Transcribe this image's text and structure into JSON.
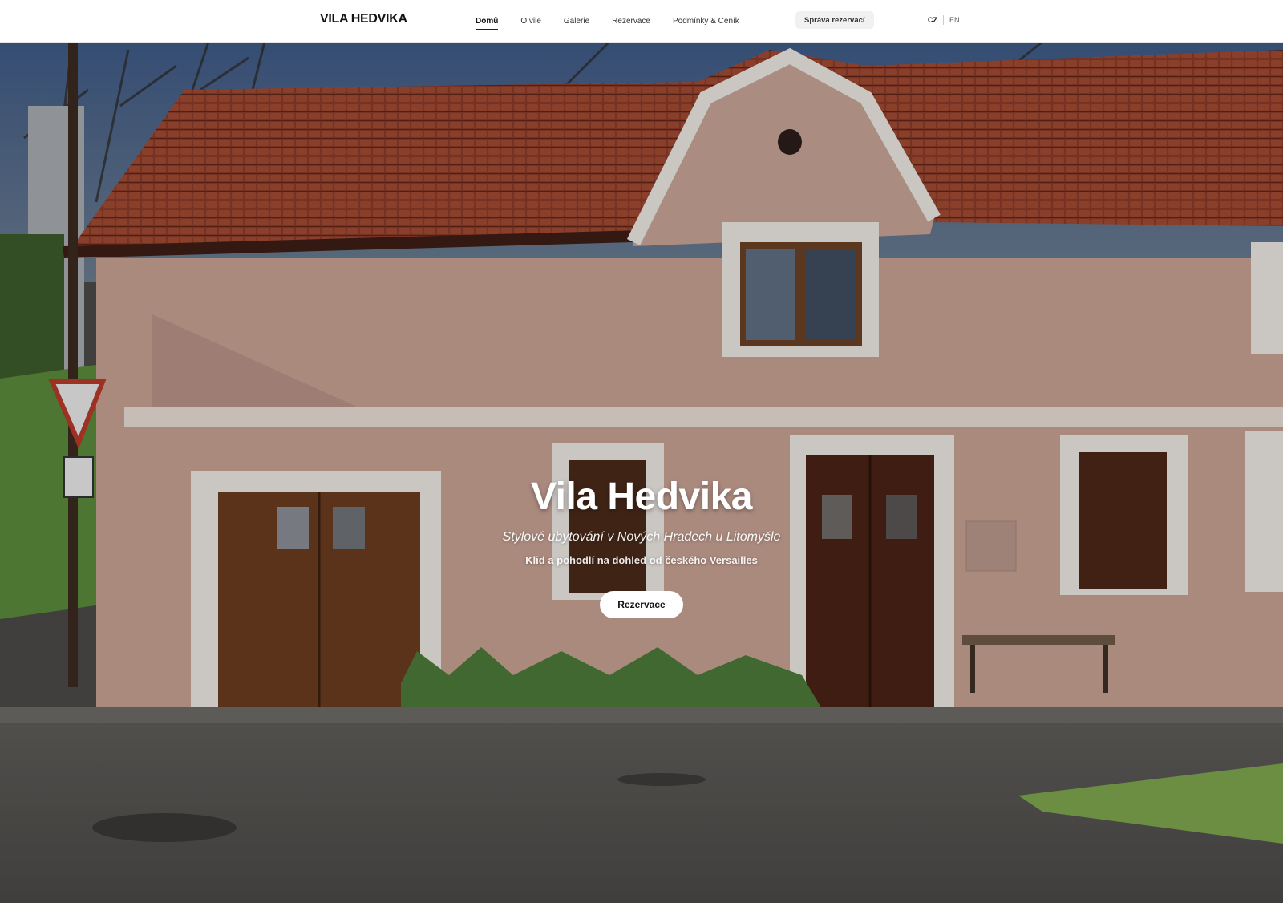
{
  "header": {
    "logo": "VILA HEDVIKA",
    "nav": [
      {
        "label": "Domů",
        "active": true
      },
      {
        "label": "O vile"
      },
      {
        "label": "Galerie"
      },
      {
        "label": "Rezervace"
      },
      {
        "label": "Podmínky & Ceník"
      }
    ],
    "manage_label": "Správa rezervací",
    "lang_cz": "CZ",
    "lang_en": "EN"
  },
  "hero": {
    "title": "Vila Hedvika",
    "subtitle": "Stylové ubytování v Nových Hradech u Litomyšle",
    "tagline": "Klid a pohodlí na dohled od českého Versailles",
    "button": "Rezervace"
  },
  "colors": {
    "roof": "#8e3e2b",
    "wall": "#c9a598",
    "trim": "#ece7e2",
    "wood": "#5c311b"
  }
}
